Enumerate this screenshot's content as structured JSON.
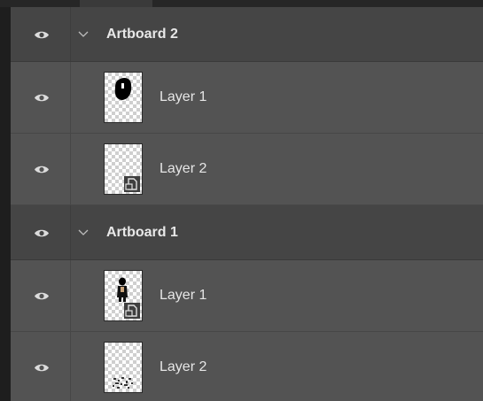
{
  "layers_panel": {
    "groups": [
      {
        "name": "Artboard 2",
        "expanded": true,
        "layers": [
          {
            "name": "Layer 1",
            "thumbnail": "black-blob",
            "smart_object": false
          },
          {
            "name": "Layer 2",
            "thumbnail": "transparent",
            "smart_object": true
          }
        ]
      },
      {
        "name": "Artboard 1",
        "expanded": true,
        "layers": [
          {
            "name": "Layer 1",
            "thumbnail": "small-figure",
            "smart_object": true
          },
          {
            "name": "Layer 2",
            "thumbnail": "speckle",
            "smart_object": false
          }
        ]
      }
    ]
  },
  "icons": {
    "visibility": "eye-icon",
    "expand": "chevron-down-icon",
    "smart_object": "smart-object-icon"
  },
  "colors": {
    "panel_bg": "#535353",
    "artboard_row_bg": "#454545",
    "text": "#e6e6e6"
  }
}
